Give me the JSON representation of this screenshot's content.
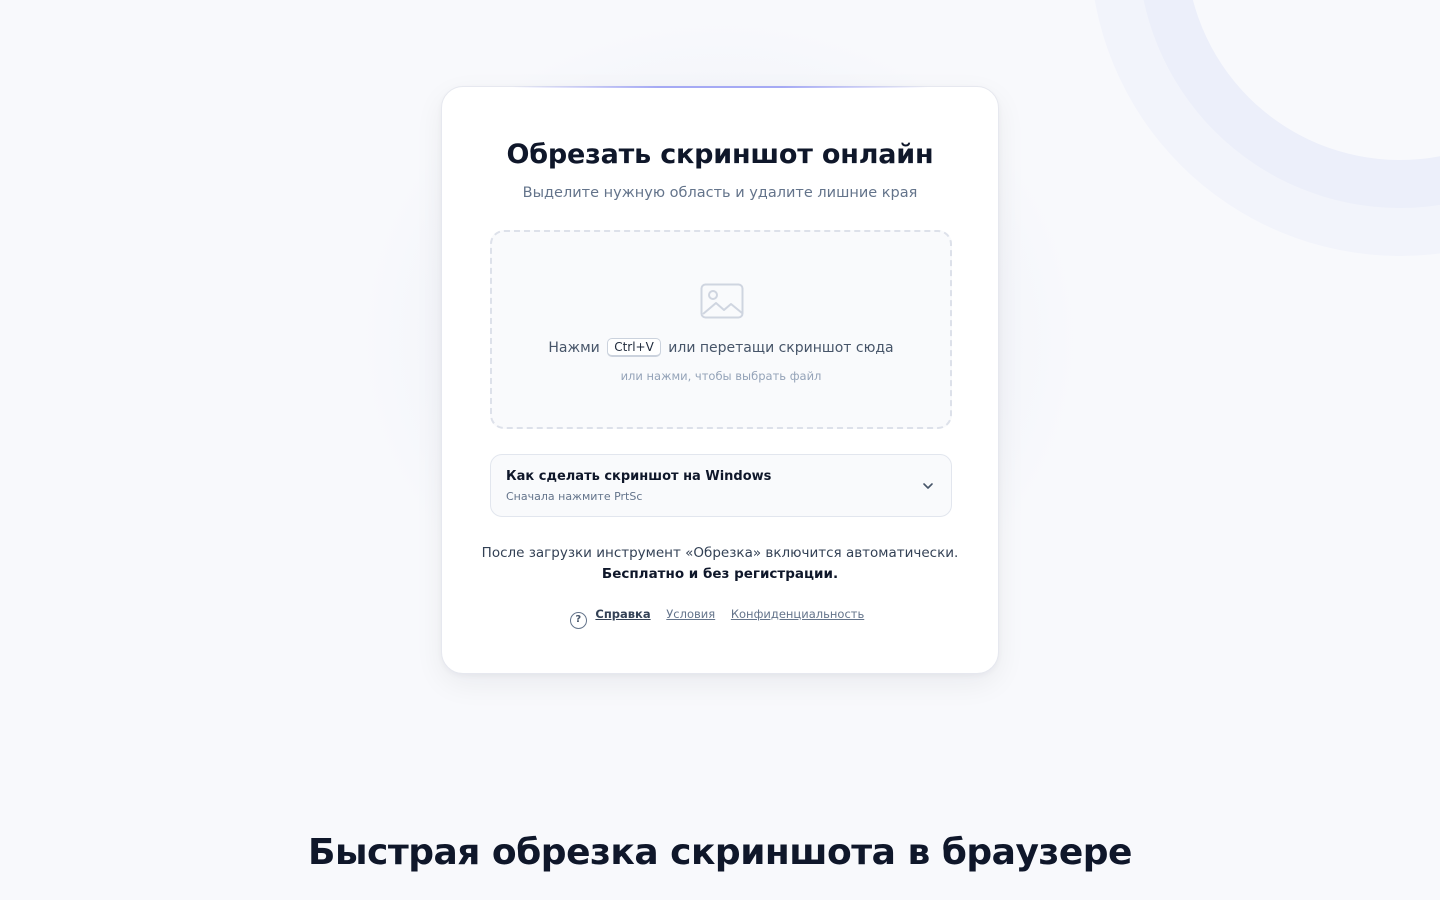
{
  "card": {
    "title": "Обрезать скриншот онлайн",
    "subtitle": "Выделите нужную область и удалите лишние края"
  },
  "dropzone": {
    "icon": "image-icon",
    "press_label": "Нажми",
    "shortcut": "Ctrl+V",
    "drag_label": "или перетащи скриншот сюда",
    "hint": "или нажми, чтобы выбрать файл"
  },
  "howto": {
    "title": "Как сделать скриншот на Windows",
    "subtitle": "Сначала нажмите PrtSc",
    "icon": "chevron-down-icon"
  },
  "note": {
    "line1": "После загрузки инструмент «Обрезка» включится автоматически.",
    "line2": "Бесплатно и без регистрации."
  },
  "footer": {
    "help_icon_glyph": "?",
    "help_label": "Справка",
    "terms_label": "Условия",
    "privacy_label": "Конфиденциальность"
  },
  "section": {
    "title": "Быстрая обрезка скриншота в браузере"
  },
  "colors": {
    "background": "#f8f9fc",
    "card": "#ffffff",
    "text": "#0f172a",
    "muted": "#64748b",
    "accent": "#a5a9f4"
  }
}
